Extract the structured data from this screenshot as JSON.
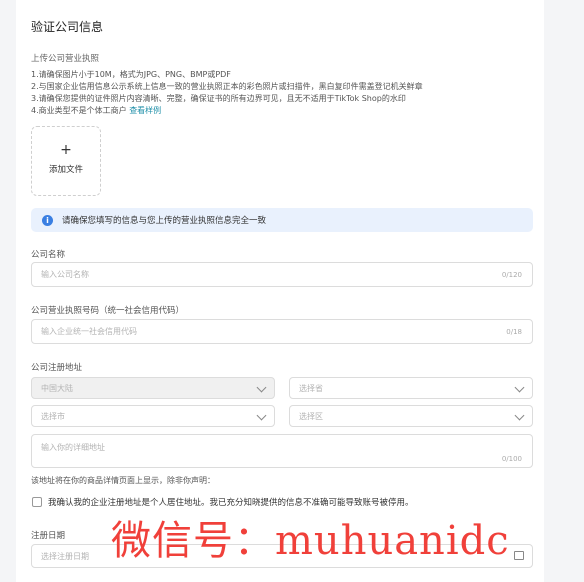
{
  "page": {
    "title": "验证公司信息",
    "upload_label": "上传公司营业执照",
    "rules": [
      "1.请确保图片小于10M，格式为JPG、PNG、BMP或PDF",
      "2.与国家企业信用信息公示系统上信息一致的营业执照正本的彩色照片或扫描件，黑白复印件需盖登记机关鲜章",
      "3.请确保您提供的证件照片内容清晰、完整，确保证书的所有边界可见，且无不适用于TikTok Shop的水印",
      "4.商业类型不是个体工商户"
    ],
    "sample_link": "查看样例",
    "upload_box": {
      "plus": "+",
      "text": "添加文件"
    },
    "notice": "请确保您填写的信息与您上传的营业执照信息完全一致",
    "company_name": {
      "label": "公司名称",
      "placeholder": "输入公司名称",
      "counter": "0/120"
    },
    "license_no": {
      "label": "公司营业执照号码（统一社会信用代码）",
      "placeholder": "输入企业统一社会信用代码",
      "counter": "0/18"
    },
    "address": {
      "label": "公司注册地址",
      "country": "中国大陆",
      "province": "选择省",
      "city": "选择市",
      "district": "选择区",
      "detail_placeholder": "输入你的详细地址",
      "detail_counter": "0/100",
      "note": "该地址将在你的商品详情页面上显示，除非你声明："
    },
    "confirm_text": "我确认我的企业注册地址是个人居住地址。我已充分知晓提供的信息不准确可能导致账号被停用。",
    "reg_date": {
      "label": "注册日期",
      "placeholder": "选择注册日期"
    },
    "watermark": "微信号：muhuanidc"
  }
}
